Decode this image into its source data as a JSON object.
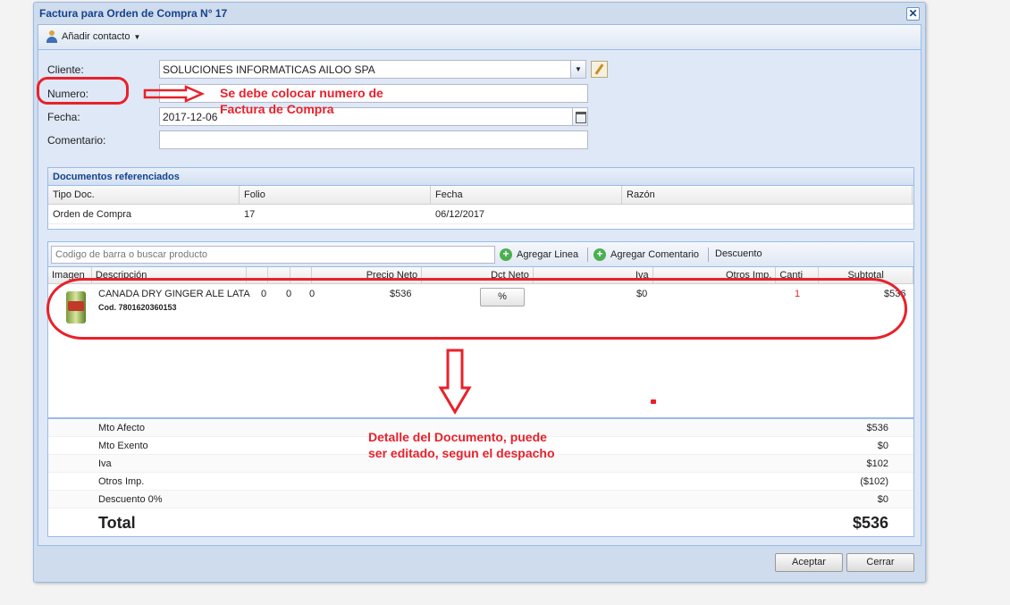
{
  "window": {
    "title": "Factura para Orden de Compra N° 17",
    "close_glyph": "✕"
  },
  "toolbar": {
    "add_contact_label": "Añadir contacto"
  },
  "form": {
    "cliente_label": "Cliente:",
    "cliente_value": "SOLUCIONES INFORMATICAS AILOO SPA",
    "numero_label": "Numero:",
    "numero_value": "",
    "fecha_label": "Fecha:",
    "fecha_value": "2017-12-06",
    "comentario_label": "Comentario:",
    "comentario_value": ""
  },
  "referenced_docs": {
    "title": "Documentos referenciados",
    "headers": [
      "Tipo Doc.",
      "Folio",
      "Fecha",
      "Razón"
    ],
    "rows": [
      [
        "Orden de Compra",
        "17",
        "06/12/2017",
        ""
      ]
    ]
  },
  "products": {
    "search_placeholder": "Codigo de barra o buscar producto",
    "add_line_label": "Agregar Linea",
    "add_comment_label": "Agregar Comentario",
    "discount_label": "Descuento",
    "headers": [
      "Imagen",
      "Descripción",
      "",
      "",
      "",
      "Precio Neto",
      "Dct Neto",
      "Iva",
      "Otros Imp.",
      "Canti",
      "Subtotal"
    ],
    "items": [
      {
        "description": "CANADA DRY GINGER ALE LATA...",
        "code": "Cod. 7801620360153",
        "col_a": "0",
        "col_b": "0",
        "col_c": "0",
        "precio_neto": "$536",
        "dct_button": "%",
        "iva": "$0",
        "quantity": "1",
        "subtotal": "$536"
      }
    ]
  },
  "totals": {
    "afecto_label": "Mto Afecto",
    "afecto_value": "$536",
    "exento_label": "Mto Exento",
    "exento_value": "$0",
    "iva_label": "Iva",
    "iva_value": "$102",
    "otros_label": "Otros Imp.",
    "otros_value": "($102)",
    "descuento_label": "Descuento 0%",
    "descuento_value": "$0",
    "total_label": "Total",
    "total_value": "$536"
  },
  "buttons": {
    "accept_label": "Aceptar",
    "cancel_label": "Cerrar"
  },
  "annotations": {
    "numero_note_line1": "Se debe colocar numero de",
    "numero_note_line2": "Factura de Compra",
    "detail_note_line1": "Detalle del Documento, puede",
    "detail_note_line2": "ser editado, segun el despacho"
  },
  "colors": {
    "annotation_red": "#e8212b",
    "title_blue": "#15428b",
    "quantity_red": "#e8212b"
  }
}
